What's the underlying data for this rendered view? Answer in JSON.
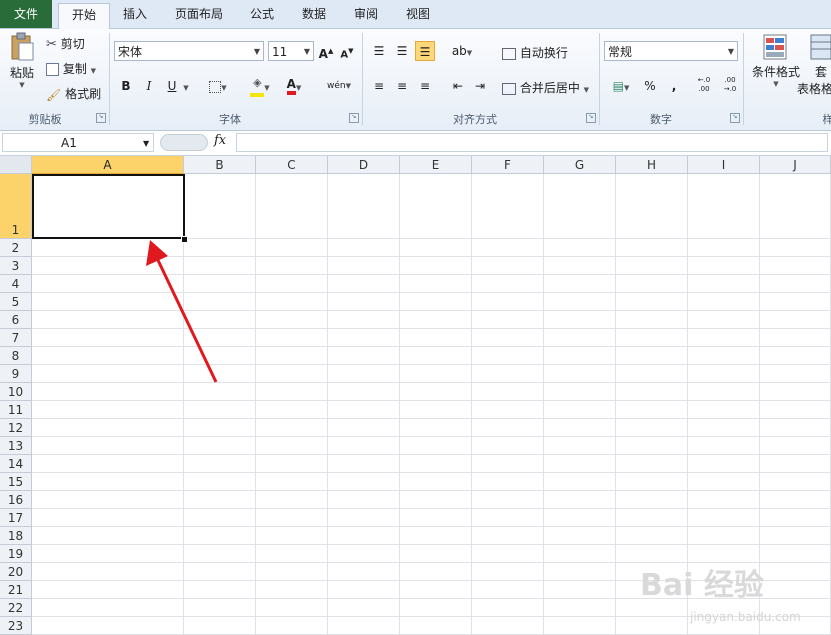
{
  "tabs": [
    "文件",
    "开始",
    "插入",
    "页面布局",
    "公式",
    "数据",
    "审阅",
    "视图"
  ],
  "ribbon": {
    "clipboard": {
      "paste": "粘贴",
      "cut": "剪切",
      "copy": "复制",
      "format_painter": "格式刷",
      "label": "剪贴板"
    },
    "font": {
      "name": "宋体",
      "size": "11",
      "bold": "B",
      "italic": "I",
      "underline": "U",
      "label": "字体",
      "grow": "A",
      "shrink": "A",
      "wen": "wén",
      "font_color": "A"
    },
    "alignment": {
      "wrap": "自动换行",
      "merge": "合并后居中",
      "label": "对齐方式"
    },
    "number": {
      "format": "常规",
      "percent": "%",
      "comma": ",",
      "inc": "←.0 .00",
      "dec": ".00 →.0",
      "label": "数字"
    },
    "styles": {
      "conditional": "条件格式",
      "table_fmt": "套",
      "table_fmt2": "表格格",
      "label": "样"
    }
  },
  "formula_bar": {
    "name_box": "A1",
    "fx": "fx",
    "value": ""
  },
  "grid": {
    "columns": [
      "A",
      "B",
      "C",
      "D",
      "E",
      "F",
      "G",
      "H",
      "I",
      "J"
    ],
    "rows": [
      "1",
      "2",
      "3",
      "4",
      "5",
      "6",
      "7",
      "8",
      "9",
      "10",
      "11",
      "12",
      "13",
      "14",
      "15",
      "16",
      "17",
      "18",
      "19",
      "20",
      "21",
      "22",
      "23"
    ],
    "selected_cell": "A1"
  },
  "watermark": {
    "text": "Bai 经验",
    "sub": "jingyan.baidu.com"
  },
  "colors": {
    "file_tab": "#2a6b3a",
    "selection_header": "#fbd36a",
    "arrow": "#e0191e"
  }
}
